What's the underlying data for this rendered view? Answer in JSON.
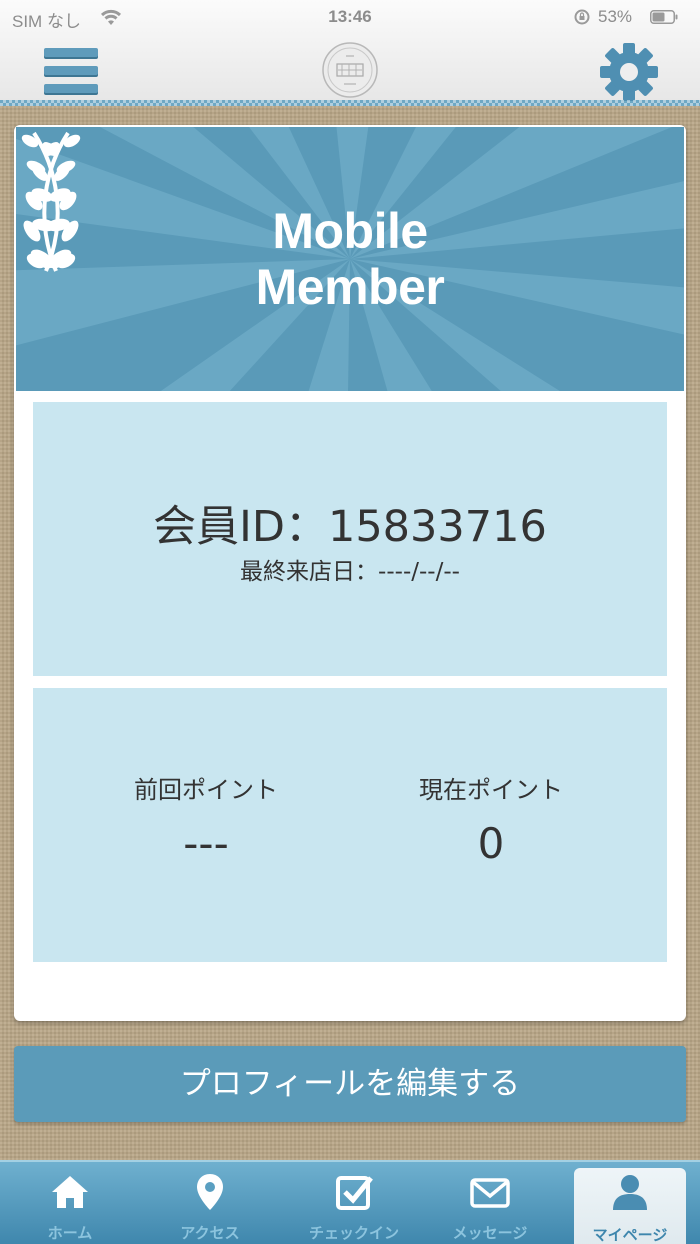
{
  "status_bar": {
    "carrier": "SIM なし",
    "time": "13:46",
    "battery": "53%",
    "icons": [
      "wifi-icon",
      "rotation-lock-icon",
      "battery-icon"
    ]
  },
  "header": {
    "menu_icon": "hamburger-icon",
    "logo_icon": "shop-logo",
    "settings_icon": "gear-icon"
  },
  "banner": {
    "title_line1": "Mobile",
    "title_line2": "Member",
    "decoration": "laurel-icon"
  },
  "member": {
    "id_text": "会員ID：15833716",
    "last_visit_text": "最終来店日：----/--/--"
  },
  "points": {
    "previous_label": "前回ポイント",
    "previous_value": "---",
    "current_label": "現在ポイント",
    "current_value": "0"
  },
  "edit_profile_label": "プロフィールを編集する",
  "tabs": [
    {
      "label": "ホーム",
      "icon": "home-icon",
      "active": false
    },
    {
      "label": "アクセス",
      "icon": "map-pin-icon",
      "active": false
    },
    {
      "label": "チェックイン",
      "icon": "checkbox-icon",
      "active": false
    },
    {
      "label": "メッセージ",
      "icon": "mail-icon",
      "active": false
    },
    {
      "label": "マイページ",
      "icon": "user-icon",
      "active": true
    }
  ],
  "colors": {
    "accent": "#5b9bb9",
    "panel": "#c9e6f0",
    "banner": "#5a9ab8",
    "background": "#b9a787"
  }
}
